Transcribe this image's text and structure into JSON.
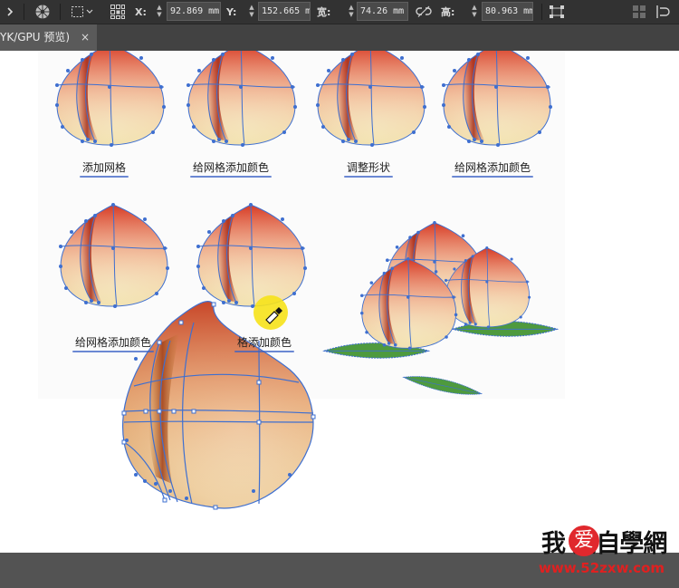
{
  "toolbar": {
    "x_label": "X:",
    "x_value": "92.869 mm",
    "y_label": "Y:",
    "y_value": "152.665 m",
    "w_label": "宽:",
    "w_value": "74.26 mm",
    "h_label": "高:",
    "h_value": "80.963 mm"
  },
  "tab": {
    "title": "YK/GPU 预览)",
    "close": "×"
  },
  "captions": [
    "添加网格",
    "给网格添加颜色",
    "调整形状",
    "给网格添加颜色",
    "给网格添加颜色",
    "格添加颜色"
  ],
  "watermark": {
    "title": "我 爱自學網",
    "heart": "爱",
    "url": "www.52zxw.com"
  },
  "colors": {
    "mesh": "#3e6fd0",
    "accent": "#e02020"
  }
}
